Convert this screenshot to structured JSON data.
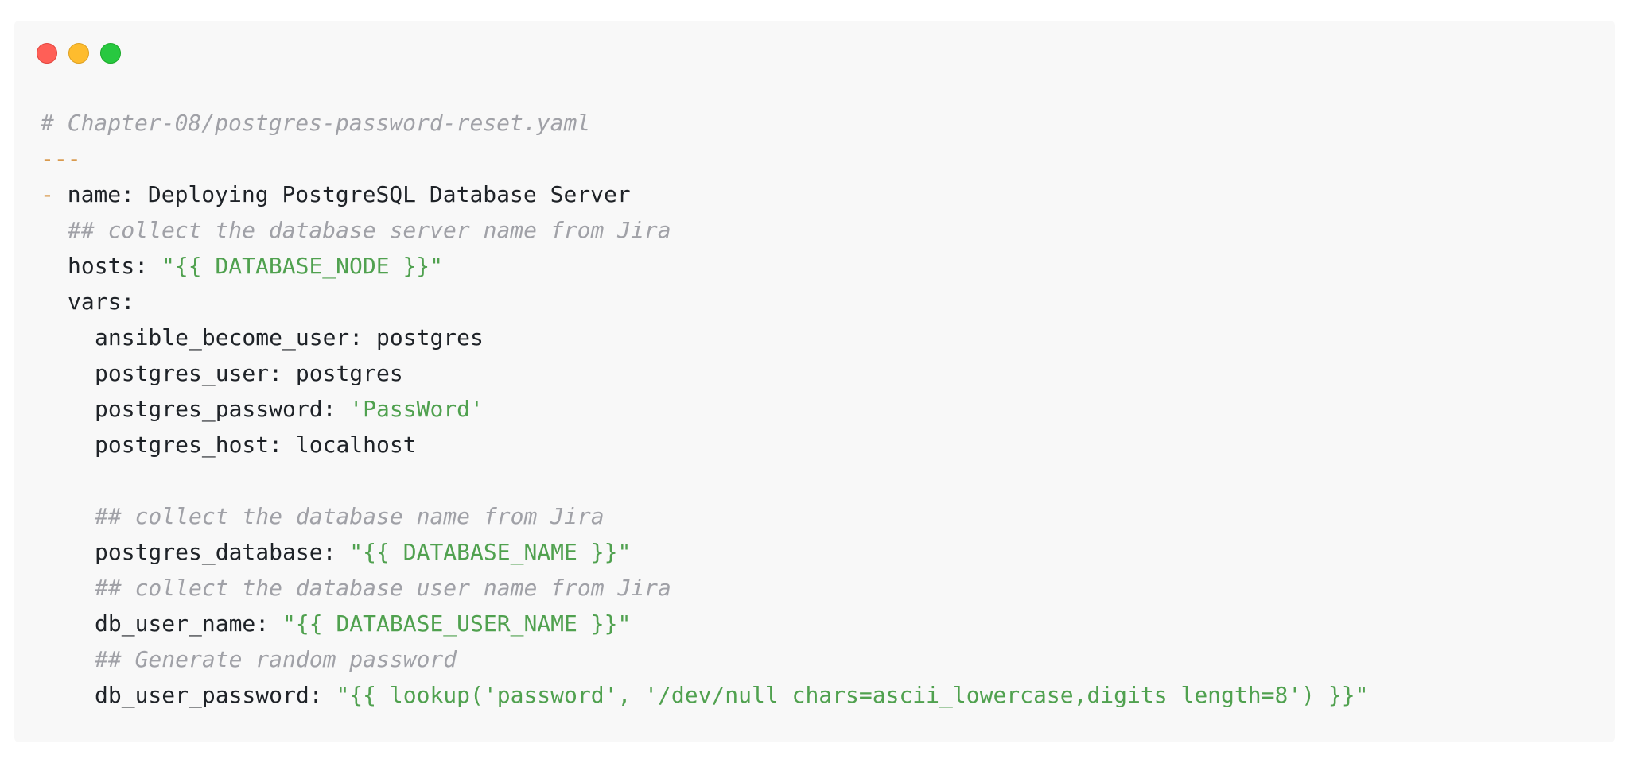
{
  "window": {
    "controls": {
      "close_color": "#ff5f57",
      "minimize_color": "#febc2e",
      "maximize_color": "#28c840"
    }
  },
  "code": {
    "file_comment": "# Chapter-08/postgres-password-reset.yaml",
    "doc_start": "---",
    "list_dash": "-",
    "name_key": "name:",
    "name_value": "Deploying PostgreSQL Database Server",
    "comment_server": "## collect the database server name from Jira",
    "hosts_key": "hosts:",
    "hosts_value": "\"{{ DATABASE_NODE }}\"",
    "vars_key": "vars:",
    "become_user_key": "ansible_become_user:",
    "become_user_value": "postgres",
    "pg_user_key": "postgres_user:",
    "pg_user_value": "postgres",
    "pg_password_key": "postgres_password:",
    "pg_password_value": "'PassWord'",
    "pg_host_key": "postgres_host:",
    "pg_host_value": "localhost",
    "comment_db_name": "## collect the database name from Jira",
    "pg_database_key": "postgres_database:",
    "pg_database_value": "\"{{ DATABASE_NAME }}\"",
    "comment_db_user": "## collect the database user name from Jira",
    "db_user_name_key": "db_user_name:",
    "db_user_name_value": "\"{{ DATABASE_USER_NAME }}\"",
    "comment_password": "## Generate random password",
    "db_user_password_key": "db_user_password:",
    "db_user_password_value": "\"{{ lookup('password', '/dev/null chars=ascii_lowercase,digits length=8') }}\""
  },
  "colors": {
    "background": "#f8f8f8",
    "comment": "#a0a1a7",
    "string": "#50a14f",
    "marker": "#d99a4e",
    "text": "#1f2328"
  }
}
